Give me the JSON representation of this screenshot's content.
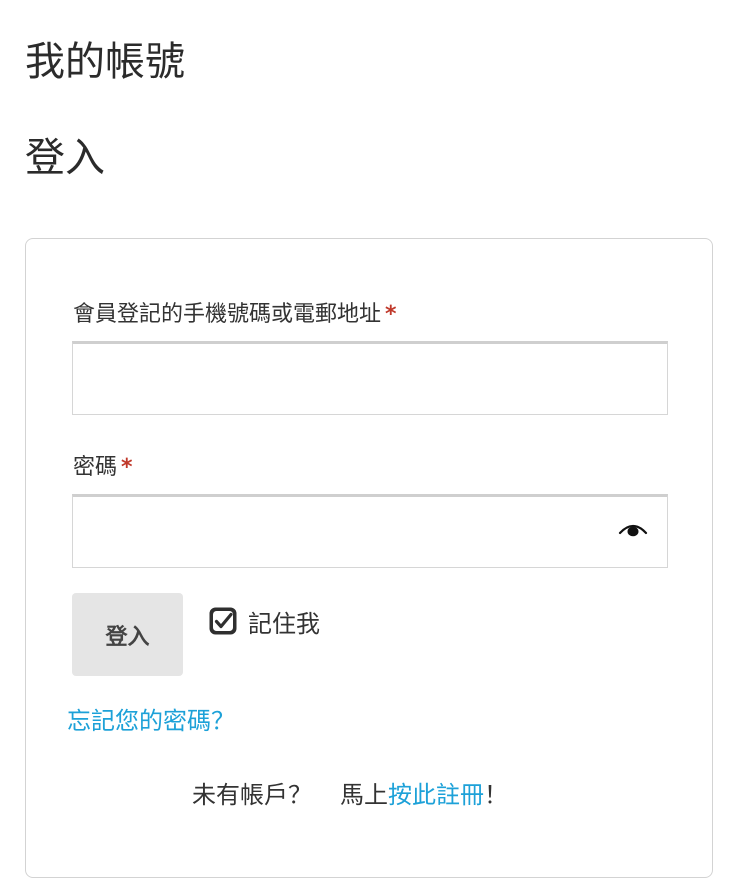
{
  "page": {
    "title": "我的帳號",
    "section_title": "登入"
  },
  "login_form": {
    "username": {
      "label": "會員登記的手機號碼或電郵地址",
      "required_mark": "*",
      "value": "",
      "placeholder": ""
    },
    "password": {
      "label": "密碼",
      "required_mark": "*",
      "value": "",
      "placeholder": "",
      "toggle_icon": "eye-icon"
    },
    "submit_label": "登入",
    "remember_me": {
      "label": "記住我",
      "checked": true
    },
    "forgot_password_link": "忘記您的密碼？",
    "signup": {
      "prompt": "未有帳戶？",
      "prefix": "馬上",
      "link_text": "按此註冊",
      "suffix": "！"
    }
  },
  "colors": {
    "link": "#1da1d8",
    "required": "#c0392b",
    "button_bg": "#e5e5e5",
    "card_border": "#d3d3d3"
  }
}
